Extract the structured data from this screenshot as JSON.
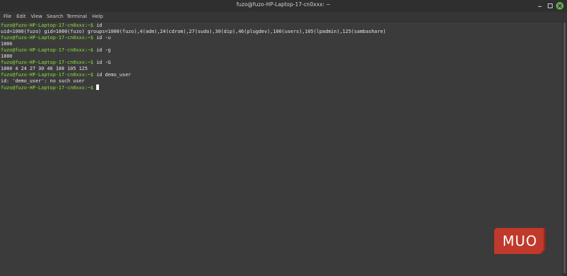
{
  "window": {
    "title": "fuzo@fuzo-HP-Laptop-17-cn0xxx: ~"
  },
  "menu": [
    "File",
    "Edit",
    "View",
    "Search",
    "Terminal",
    "Help"
  ],
  "terminal": {
    "prompt": "fuzo@fuzo-HP-Laptop-17-cn0xxx:~$",
    "lines": [
      {
        "type": "cmd",
        "text": " id"
      },
      {
        "type": "out",
        "text": "uid=1000(fuzo) gid=1000(fuzo) groups=1000(fuzo),4(adm),24(cdrom),27(sudo),30(dip),46(plugdev),100(users),105(lpadmin),125(sambashare)"
      },
      {
        "type": "cmd",
        "text": " id -u"
      },
      {
        "type": "out",
        "text": "1000"
      },
      {
        "type": "cmd",
        "text": " id -g"
      },
      {
        "type": "out",
        "text": "1000"
      },
      {
        "type": "cmd",
        "text": " id -G"
      },
      {
        "type": "out",
        "text": "1000 4 24 27 30 46 100 105 125"
      },
      {
        "type": "cmd",
        "text": " id demo_user"
      },
      {
        "type": "out",
        "text": "id: 'demo_user': no such user"
      },
      {
        "type": "cmd",
        "text": " "
      }
    ]
  },
  "watermark": {
    "text": "MUO",
    "color": "#c0392b"
  },
  "colors": {
    "prompt": "#8ae234",
    "close_button": "#6aa84f"
  }
}
